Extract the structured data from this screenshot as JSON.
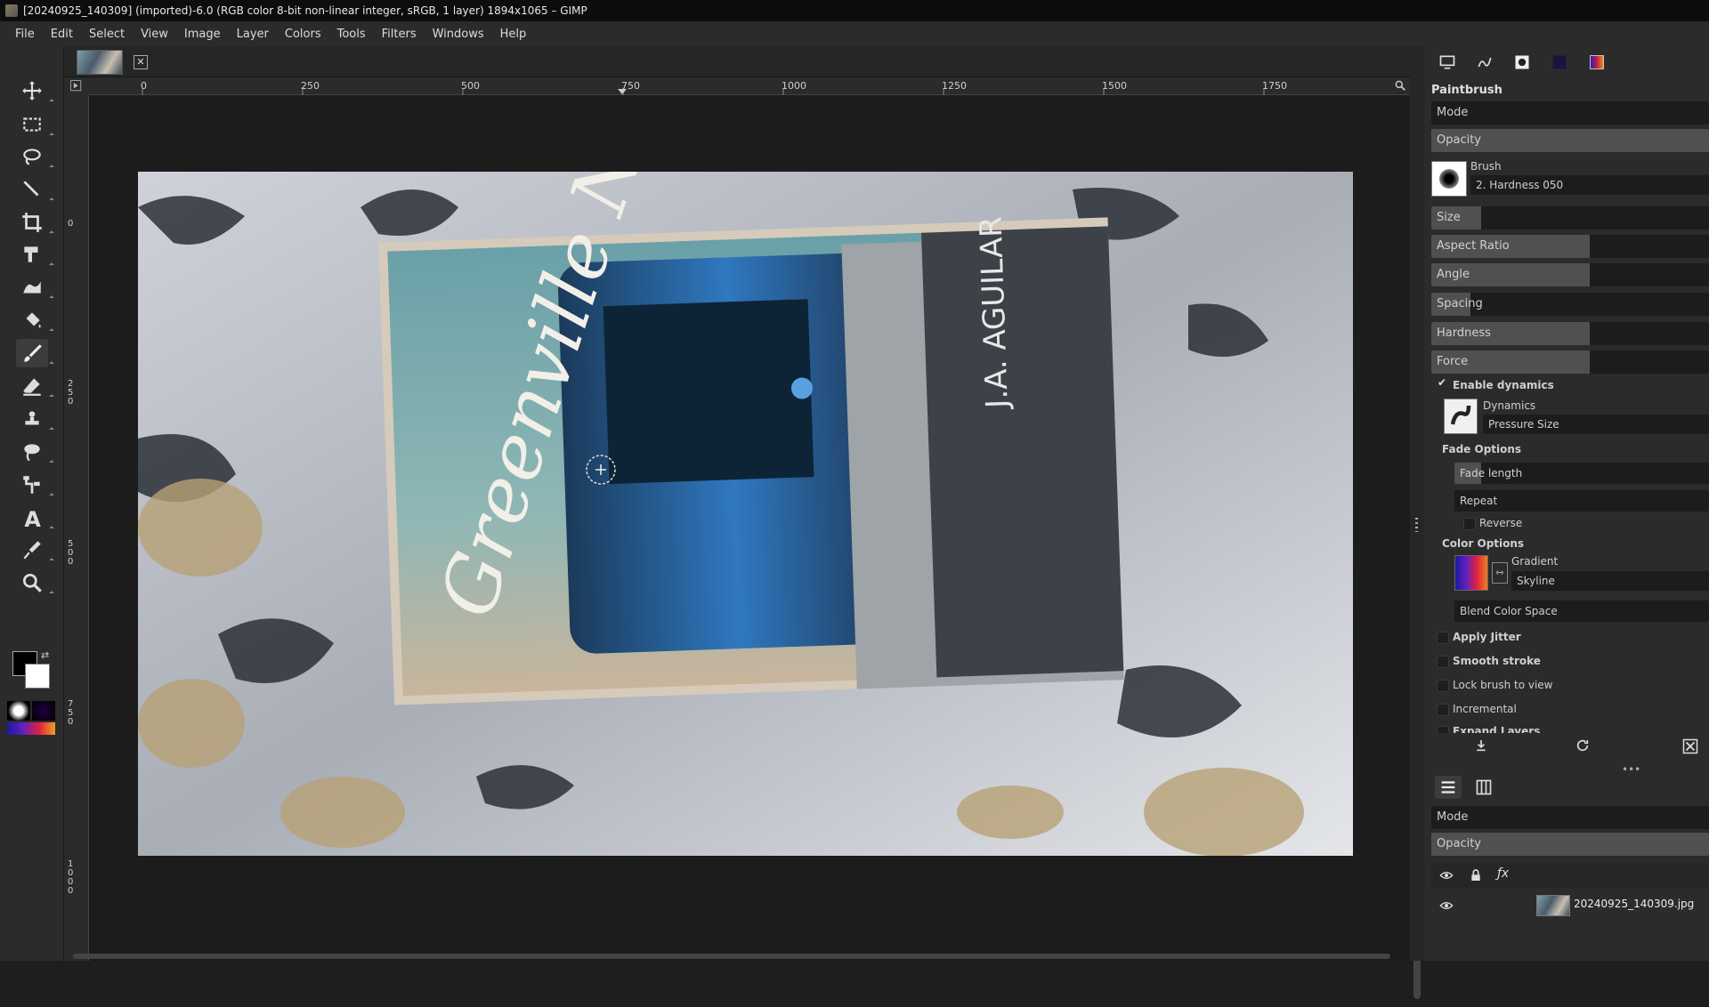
{
  "window": {
    "title": "[20240925_140309] (imported)-6.0 (RGB color 8-bit non-linear integer, sRGB, 1 layer) 1894x1065 – GIMP"
  },
  "menu": [
    "File",
    "Edit",
    "Select",
    "View",
    "Image",
    "Layer",
    "Colors",
    "Tools",
    "Filters",
    "Windows",
    "Help"
  ],
  "ruler": {
    "h_labels": [
      "0",
      "250",
      "500",
      "750",
      "1000",
      "1250",
      "1500",
      "1750"
    ],
    "v_labels": [
      "0",
      "250",
      "500",
      "750",
      "1000"
    ]
  },
  "tool_options": {
    "title": "Paintbrush",
    "mode_label": "Mode",
    "opacity_label": "Opacity",
    "brush_label": "Brush",
    "brush_name": "2. Hardness 050",
    "size_label": "Size",
    "aspect_label": "Aspect Ratio",
    "angle_label": "Angle",
    "spacing_label": "Spacing",
    "hardness_label": "Hardness",
    "force_label": "Force",
    "enable_dynamics": "Enable dynamics",
    "dynamics_label": "Dynamics",
    "dynamics_name": "Pressure Size",
    "fade_options": "Fade Options",
    "fade_length": "Fade length",
    "repeat_label": "Repeat",
    "reverse_label": "Reverse",
    "color_options": "Color Options",
    "gradient_label": "Gradient",
    "gradient_name": "Skyline",
    "blend_space": "Blend Color Space",
    "apply_jitter": "Apply Jitter",
    "smooth_stroke": "Smooth stroke",
    "lock_brush": "Lock brush to view",
    "incremental": "Incremental",
    "expand_layers": "Expand Layers"
  },
  "layers": {
    "mode_label": "Mode",
    "opacity_label": "Opacity",
    "layer_name": "20240925_140309.jpg"
  },
  "photo": {
    "book_title": "Greenville Nights",
    "author": "J.A. AGUILAR"
  },
  "colors": {
    "foreground": "#000000",
    "background": "#ffffff",
    "panel": "#2b2b2b",
    "canvas": "#1c1c1c"
  }
}
